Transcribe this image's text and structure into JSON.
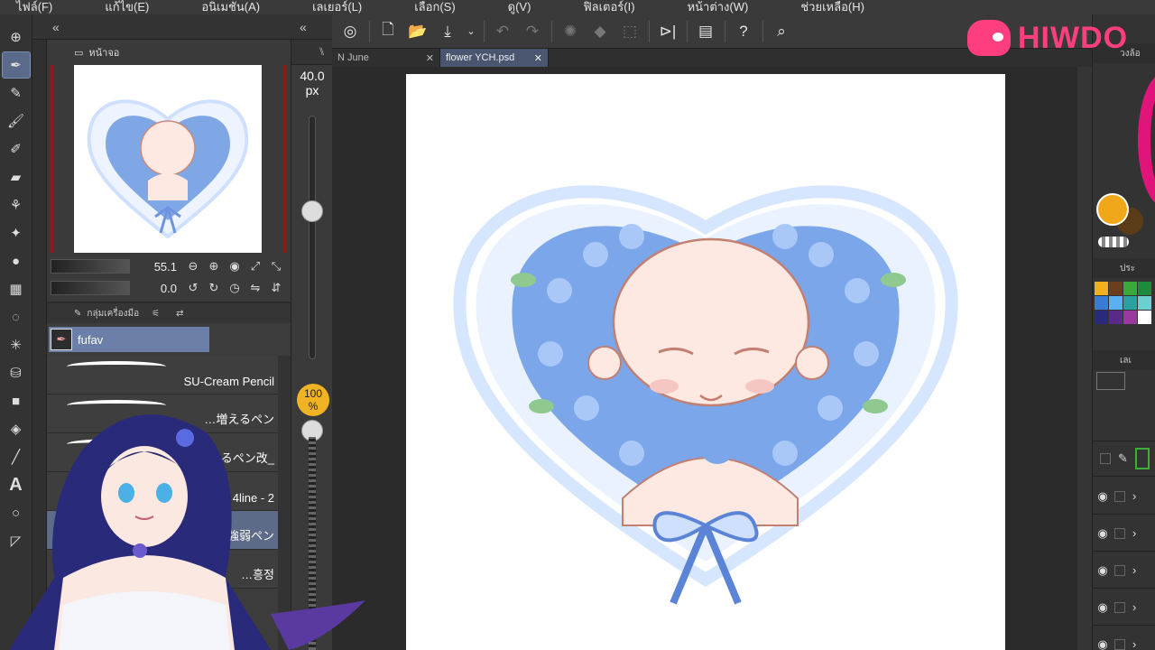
{
  "menu": [
    "ไฟล์(F)",
    "แก้ไข(E)",
    "อนิเมชัน(A)",
    "เลเยอร์(L)",
    "เลือก(S)",
    "ดู(V)",
    "ฟิลเตอร์(I)",
    "หน้าต่าง(W)",
    "ช่วยเหลือ(H)"
  ],
  "navigator": {
    "tab_label": "หน้าจอ",
    "zoom_value": "55.1",
    "rotate_value": "0.0"
  },
  "subtool": {
    "tab_label": "กลุ่มเครื่องมือ",
    "selected_group": "fufav",
    "brushes": [
      {
        "name": "SU-Cream Pencil",
        "selected": false
      },
      {
        "name": "…増えるペン",
        "selected": false
      },
      {
        "name": "…えるペン改_",
        "selected": false
      },
      {
        "name": "ll 4line - 2",
        "selected": false
      },
      {
        "name": "…細強弱ペン",
        "selected": true
      },
      {
        "name": "…흥정",
        "selected": false
      }
    ]
  },
  "brush_size": {
    "value": "40.0",
    "unit": "px",
    "opacity_label": "100",
    "opacity_unit": "%"
  },
  "doc_tabs": [
    {
      "label": "N June",
      "active": false
    },
    {
      "label": "flower YCH.psd",
      "active": true
    }
  ],
  "right_panel": {
    "color_tab": "วงล้อ",
    "palette_tab": "ประ",
    "layer_tab": "เลเ"
  },
  "logo": {
    "text": "HIWDO"
  },
  "colors": {
    "accent": "#ff3e7f",
    "selection": "#6b7fa8",
    "main_color": "#f0a81a",
    "opacity_badge": "#f0b323"
  },
  "icons": {
    "tools": [
      "move-icon",
      "pen-icon",
      "pencil-icon",
      "brush-icon",
      "airbrush-icon",
      "eraser-icon",
      "blend-icon",
      "sparkle-icon",
      "fill-drop-icon",
      "grid-icon",
      "lasso-icon",
      "magic-wand-icon",
      "bucket-icon",
      "gradient-icon",
      "figure-icon",
      "line-icon",
      "text-icon",
      "balloon-icon",
      "correct-line-icon"
    ]
  }
}
